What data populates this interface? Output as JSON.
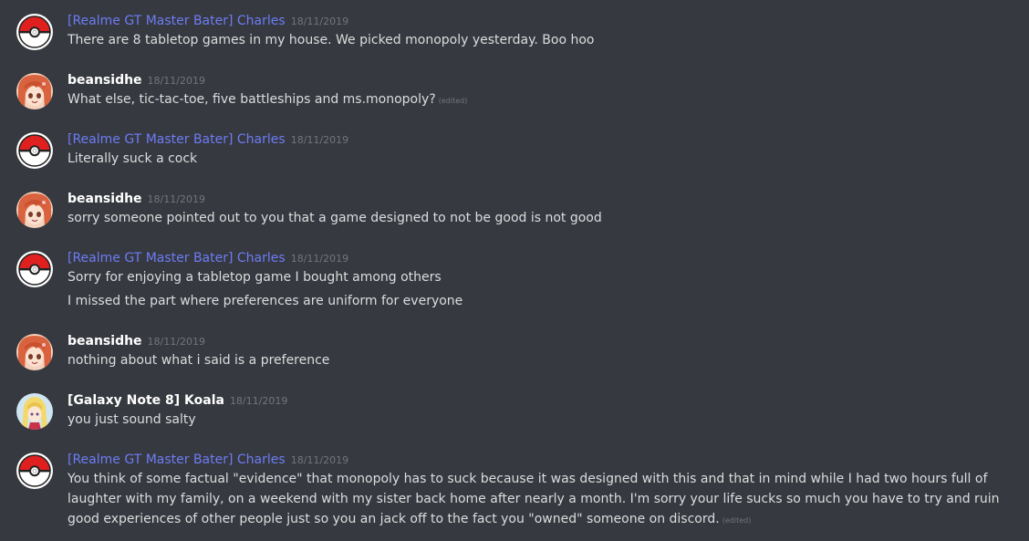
{
  "messages": [
    {
      "author": "[Realme GT Master Bater] Charles",
      "timestamp": "18/11/2019",
      "lines": [
        "There are 8 tabletop games in my house. We picked monopoly yesterday. Boo hoo"
      ]
    },
    {
      "author": "beansidhe",
      "timestamp": "18/11/2019",
      "lines": [
        "What else, tic-tac-toe, five battleships and ms.monopoly?"
      ],
      "edited": "(edited)"
    },
    {
      "author": "[Realme GT Master Bater] Charles",
      "timestamp": "18/11/2019",
      "lines": [
        "Literally suck a cock"
      ]
    },
    {
      "author": "beansidhe",
      "timestamp": "18/11/2019",
      "lines": [
        "sorry someone pointed out to you that a game designed to not be good is not good"
      ]
    },
    {
      "author": "[Realme GT Master Bater] Charles",
      "timestamp": "18/11/2019",
      "lines": [
        "Sorry for enjoying a tabletop game I bought among others",
        "I missed the part where preferences are uniform for everyone"
      ]
    },
    {
      "author": "beansidhe",
      "timestamp": "18/11/2019",
      "lines": [
        "nothing about what i said is a preference"
      ]
    },
    {
      "author": "[Galaxy Note 8] Koala",
      "timestamp": "18/11/2019",
      "lines": [
        "you just sound salty"
      ]
    },
    {
      "author": "[Realme GT Master Bater] Charles",
      "timestamp": "18/11/2019",
      "lines": [
        "You think of some factual \"evidence\" that monopoly has to suck because it was designed with this and that in mind while I had two hours full of laughter with my family, on a weekend with my sister back home after nearly a month. I'm sorry your life sucks so much you have to try and ruin good experiences of other people just so you an jack off to the fact you \"owned\" someone on discord."
      ],
      "edited": "(edited)"
    }
  ],
  "colors": {
    "background": "#36393f",
    "role_blue": "#6d7cf5",
    "text": "#dcddde",
    "muted": "#72767d"
  },
  "icons": {
    "charles": "pokeball-avatar-icon",
    "beansidhe": "anime-girl-avatar-icon",
    "koala": "blonde-anime-avatar-icon"
  }
}
